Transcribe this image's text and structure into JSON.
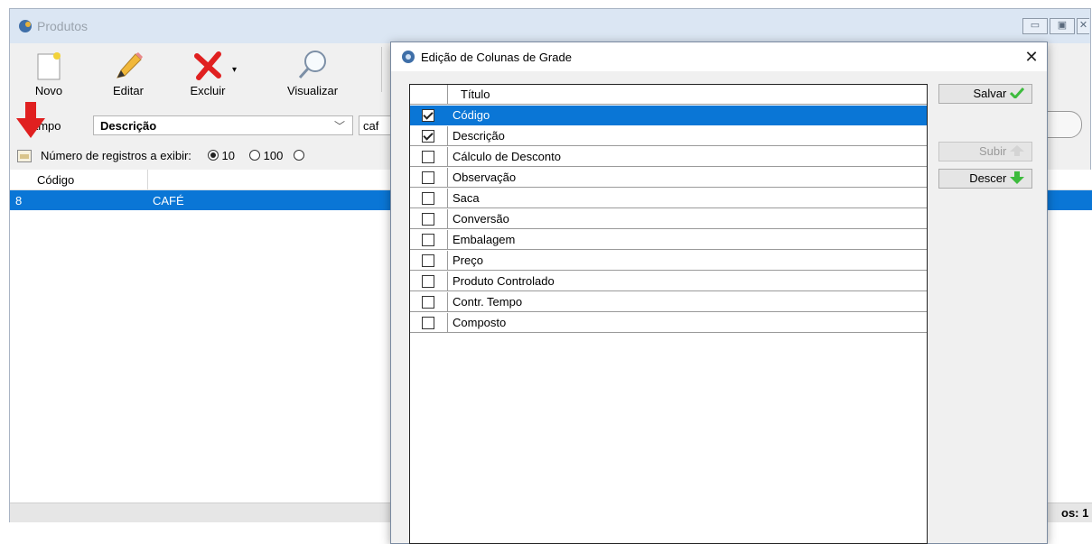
{
  "main_window": {
    "title": "Produtos",
    "toolbar": [
      {
        "label": "Novo",
        "icon": "new-document-icon"
      },
      {
        "label": "Editar",
        "icon": "pencil-icon"
      },
      {
        "label": "Excluir",
        "icon": "delete-x-icon"
      },
      {
        "label": "Visualizar",
        "icon": "magnifier-icon"
      }
    ],
    "search": {
      "field_label": "ampo",
      "field_selected": "Descrição",
      "query": "caf"
    },
    "records": {
      "label": "Número de registros a exibir:",
      "options": [
        "10",
        "100"
      ],
      "selected": "10"
    },
    "grid": {
      "columns": [
        "Código"
      ],
      "rows": [
        {
          "codigo": "8",
          "descricao": "CAFÉ"
        }
      ]
    },
    "status_suffix": "os: 1"
  },
  "dialog": {
    "title": "Edição de Colunas de Grade",
    "table_header": "Título",
    "columns": [
      {
        "label": "Código",
        "checked": true,
        "selected": true
      },
      {
        "label": "Descrição",
        "checked": true,
        "selected": false
      },
      {
        "label": "Cálculo de Desconto",
        "checked": false,
        "selected": false
      },
      {
        "label": "Observação",
        "checked": false,
        "selected": false
      },
      {
        "label": "Saca",
        "checked": false,
        "selected": false
      },
      {
        "label": "Conversão",
        "checked": false,
        "selected": false
      },
      {
        "label": "Embalagem",
        "checked": false,
        "selected": false
      },
      {
        "label": "Preço",
        "checked": false,
        "selected": false
      },
      {
        "label": "Produto Controlado",
        "checked": false,
        "selected": false
      },
      {
        "label": "Contr. Tempo",
        "checked": false,
        "selected": false
      },
      {
        "label": "Composto",
        "checked": false,
        "selected": false
      }
    ],
    "buttons": {
      "save": "Salvar",
      "up": "Subir",
      "down": "Descer"
    }
  },
  "colors": {
    "selection": "#0a76d6",
    "accent_red": "#e02020",
    "save_check": "#3dbb3d"
  }
}
